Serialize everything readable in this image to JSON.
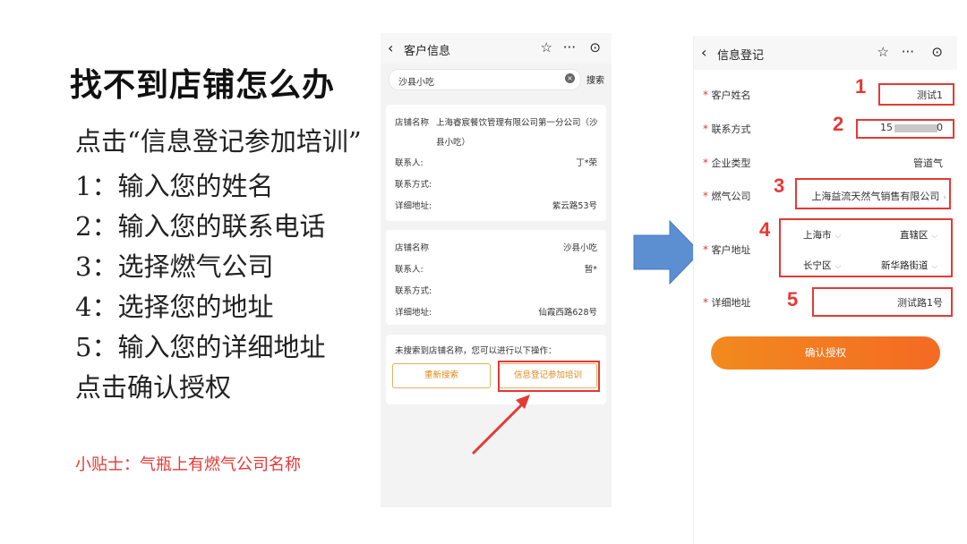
{
  "slide": {
    "title": "找不到店铺怎么办",
    "steps": [
      "点击“信息登记参加培训”",
      "1：输入您的姓名",
      "2：输入您的联系电话",
      "3：选择燃气公司",
      "4：选择您的地址",
      "5：输入您的详细地址",
      "点击确认授权"
    ],
    "tip": "小贴士：气瓶上有燃气公司名称"
  },
  "phone1": {
    "nav_title": "客户信息",
    "search_value": "沙县小吃",
    "search_button": "搜索",
    "stores": [
      {
        "name_label": "店铺名称",
        "name_line1": "上海睿宸餐饮管理有限公司第一分公司（沙",
        "name_line2": "县小吃）",
        "contact_label": "联系人:",
        "contact": "丁*荣",
        "phone_label": "联系方式:",
        "phone": "",
        "address_label": "详细地址:",
        "address": "紫云路53号"
      },
      {
        "name_label": "店铺名称",
        "name": "沙县小吃",
        "contact_label": "联系人:",
        "contact": "暂*",
        "phone_label": "联系方式:",
        "phone": "",
        "address_label": "详细地址:",
        "address": "仙霞西路628号"
      }
    ],
    "not_found_text": "未搜索到店铺名称，您可以进行以下操作：",
    "research_button": "重新搜索",
    "register_button": "信息登记参加培训"
  },
  "phone2": {
    "nav_title": "信息登记",
    "fields": {
      "name_label": "客户姓名",
      "name_value": "测试1",
      "phone_label": "联系方式",
      "phone_value_start": "15",
      "phone_value_end": "0",
      "type_label": "企业类型",
      "type_value": "管道气",
      "gas_label": "燃气公司",
      "gas_value": "上海益流天然气销售有限公司",
      "addr_label": "客户地址",
      "city": "上海市",
      "district": "直辖区",
      "area": "长宁区",
      "street": "新华路街道",
      "detail_label": "详细地址",
      "detail_value": "测试路1号"
    },
    "numbers": [
      "1",
      "2",
      "3",
      "4",
      "5"
    ],
    "confirm_button": "确认授权"
  },
  "colors": {
    "accent_red": "#e53935",
    "button_orange": "#f47a1f",
    "arrow_blue": "#5b8fd1"
  }
}
